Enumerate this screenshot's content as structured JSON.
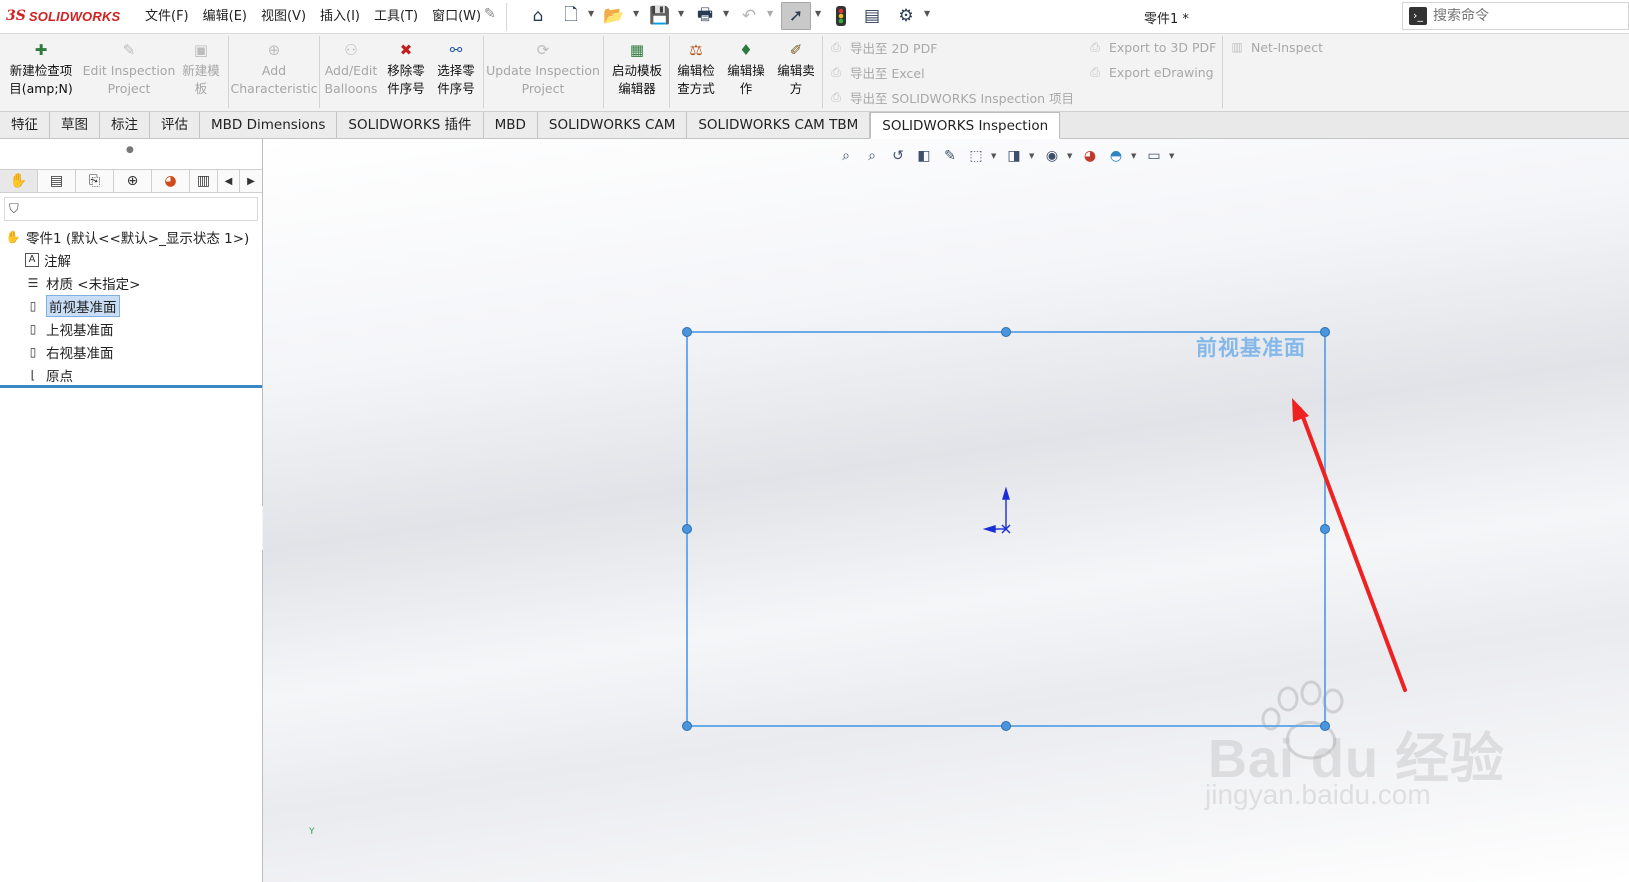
{
  "app": {
    "logo_prefix": "3S",
    "logo_name": "SOLIDWORKS",
    "document_title": "零件1 *"
  },
  "menus": [
    "文件(F)",
    "编辑(E)",
    "视图(V)",
    "插入(I)",
    "工具(T)",
    "窗口(W)"
  ],
  "quick_access": {
    "icons": [
      "home-icon",
      "new-document-icon",
      "open-icon",
      "save-icon",
      "print-icon",
      "undo-icon",
      "select-arrow-icon",
      "traffic-light-icon",
      "file-properties-icon",
      "options-gear-icon"
    ]
  },
  "search": {
    "placeholder": "搜索命令"
  },
  "ribbon": {
    "buttons": [
      {
        "label_line1": "新建检查项",
        "label_line2": "目(amp;N)",
        "enabled": true
      },
      {
        "label_line1": "Edit Inspection",
        "label_line2": "Project",
        "enabled": false
      },
      {
        "label_line1": "新建模",
        "label_line2": "板",
        "enabled": false
      },
      {
        "label_line1": "Add",
        "label_line2": "Characteristic",
        "enabled": false
      },
      {
        "label_line1": "Add/Edit",
        "label_line2": "Balloons",
        "enabled": false
      },
      {
        "label_line1": "移除零",
        "label_line2": "件序号",
        "enabled": true
      },
      {
        "label_line1": "选择零",
        "label_line2": "件序号",
        "enabled": true
      },
      {
        "label_line1": "Update Inspection",
        "label_line2": "Project",
        "enabled": false
      },
      {
        "label_line1": "启动模板",
        "label_line2": "编辑器",
        "enabled": true
      },
      {
        "label_line1": "编辑检",
        "label_line2": "查方式",
        "enabled": true
      },
      {
        "label_line1": "编辑操",
        "label_line2": "作",
        "enabled": true
      },
      {
        "label_line1": "编辑卖",
        "label_line2": "方",
        "enabled": true
      }
    ],
    "exports_left": [
      "导出至 2D PDF",
      "导出至 Excel",
      "导出至 SOLIDWORKS Inspection 项目"
    ],
    "exports_right": [
      "Export to 3D PDF",
      "Export eDrawing"
    ],
    "net_inspect": "Net-Inspect"
  },
  "tabs": [
    {
      "label": "特征",
      "active": false
    },
    {
      "label": "草图",
      "active": false
    },
    {
      "label": "标注",
      "active": false
    },
    {
      "label": "评估",
      "active": false
    },
    {
      "label": "MBD Dimensions",
      "active": false
    },
    {
      "label": "SOLIDWORKS 插件",
      "active": false
    },
    {
      "label": "MBD",
      "active": false
    },
    {
      "label": "SOLIDWORKS CAM",
      "active": false
    },
    {
      "label": "SOLIDWORKS CAM TBM",
      "active": false
    },
    {
      "label": "SOLIDWORKS Inspection",
      "active": true
    }
  ],
  "feature_tree": {
    "root": "零件1  (默认<<默认>_显示状态 1>)",
    "items": [
      {
        "label": "注解",
        "icon": "annotations-icon",
        "selected": false
      },
      {
        "label": "材质 <未指定>",
        "icon": "material-icon",
        "selected": false
      },
      {
        "label": "前视基准面",
        "icon": "plane-icon",
        "selected": true
      },
      {
        "label": "上视基准面",
        "icon": "plane-icon",
        "selected": false
      },
      {
        "label": "右视基准面",
        "icon": "plane-icon",
        "selected": false
      },
      {
        "label": "原点",
        "icon": "origin-icon",
        "selected": false
      }
    ]
  },
  "graphics": {
    "plane_label": "前视基准面",
    "triad_y_label": "Y",
    "watermark": "Bai du 经验",
    "watermark_sub": "jingyan.baidu.com",
    "colors": {
      "plane": "#5ca3e6",
      "annotation_arrow": "#ee2222",
      "origin": "#1a2fd6"
    }
  }
}
